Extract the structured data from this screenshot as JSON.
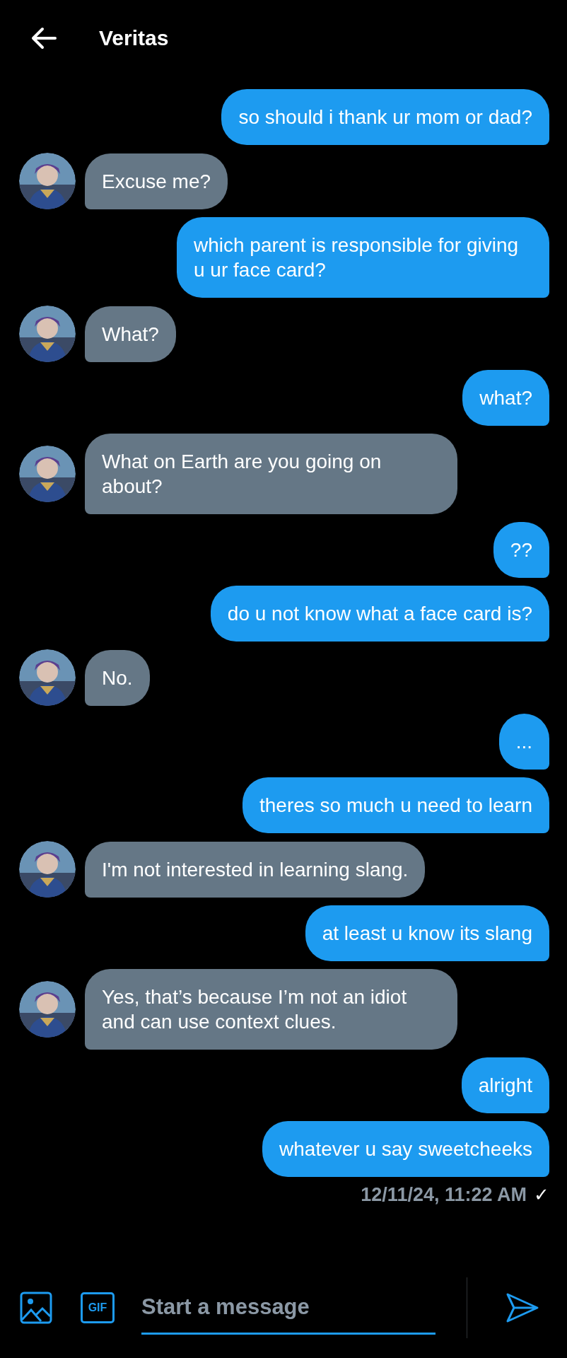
{
  "header": {
    "title": "Veritas"
  },
  "messages": [
    {
      "kind": "sent",
      "text": "so should i thank ur mom or dad?"
    },
    {
      "kind": "received",
      "text": "Excuse me?"
    },
    {
      "kind": "sent",
      "text": "which parent is responsible for giving u ur face card?"
    },
    {
      "kind": "received",
      "text": "What?"
    },
    {
      "kind": "sent",
      "text": "what?"
    },
    {
      "kind": "received",
      "text": "What on Earth are you going on about?"
    },
    {
      "kind": "sent",
      "text": "??"
    },
    {
      "kind": "sent",
      "text": "do u not know what a face card is?"
    },
    {
      "kind": "received",
      "text": "No."
    },
    {
      "kind": "sent",
      "text": "..."
    },
    {
      "kind": "sent",
      "text": "theres so much u need to learn"
    },
    {
      "kind": "received",
      "text": "I'm not interested in learning slang."
    },
    {
      "kind": "sent",
      "text": "at least u know its slang"
    },
    {
      "kind": "received",
      "text": "Yes, that’s because I’m not an idiot and can use context clues."
    },
    {
      "kind": "sent",
      "text": "alright"
    },
    {
      "kind": "sent",
      "text": "whatever u say sweetcheeks"
    }
  ],
  "timestamp": "12/11/24, 11:22 AM",
  "read_mark": "✓",
  "composer": {
    "gif_label": "GIF",
    "placeholder": "Start a message"
  }
}
